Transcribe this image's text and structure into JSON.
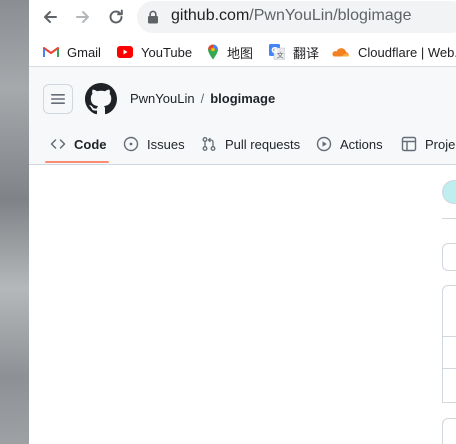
{
  "browser": {
    "url_host": "github.com",
    "url_path": "/PwnYouLin/blogimage"
  },
  "bookmarks": [
    {
      "label": "Gmail",
      "icon": "gmail-icon"
    },
    {
      "label": "YouTube",
      "icon": "youtube-icon"
    },
    {
      "label": "地图",
      "icon": "maps-icon"
    },
    {
      "label": "翻译",
      "icon": "translate-icon"
    },
    {
      "label": "Cloudflare | Web...",
      "icon": "cloudflare-icon"
    }
  ],
  "repo": {
    "owner": "PwnYouLin",
    "separator": "/",
    "name": "blogimage"
  },
  "tabs": [
    {
      "label": "Code",
      "icon": "code-icon",
      "selected": true
    },
    {
      "label": "Issues",
      "icon": "issues-icon"
    },
    {
      "label": "Pull requests",
      "icon": "pull-request-icon"
    },
    {
      "label": "Actions",
      "icon": "actions-icon"
    },
    {
      "label": "Projects",
      "icon": "projects-icon"
    }
  ],
  "colors": {
    "tab_underline": "#fd8c73",
    "header_bg": "#f6f8fa"
  }
}
